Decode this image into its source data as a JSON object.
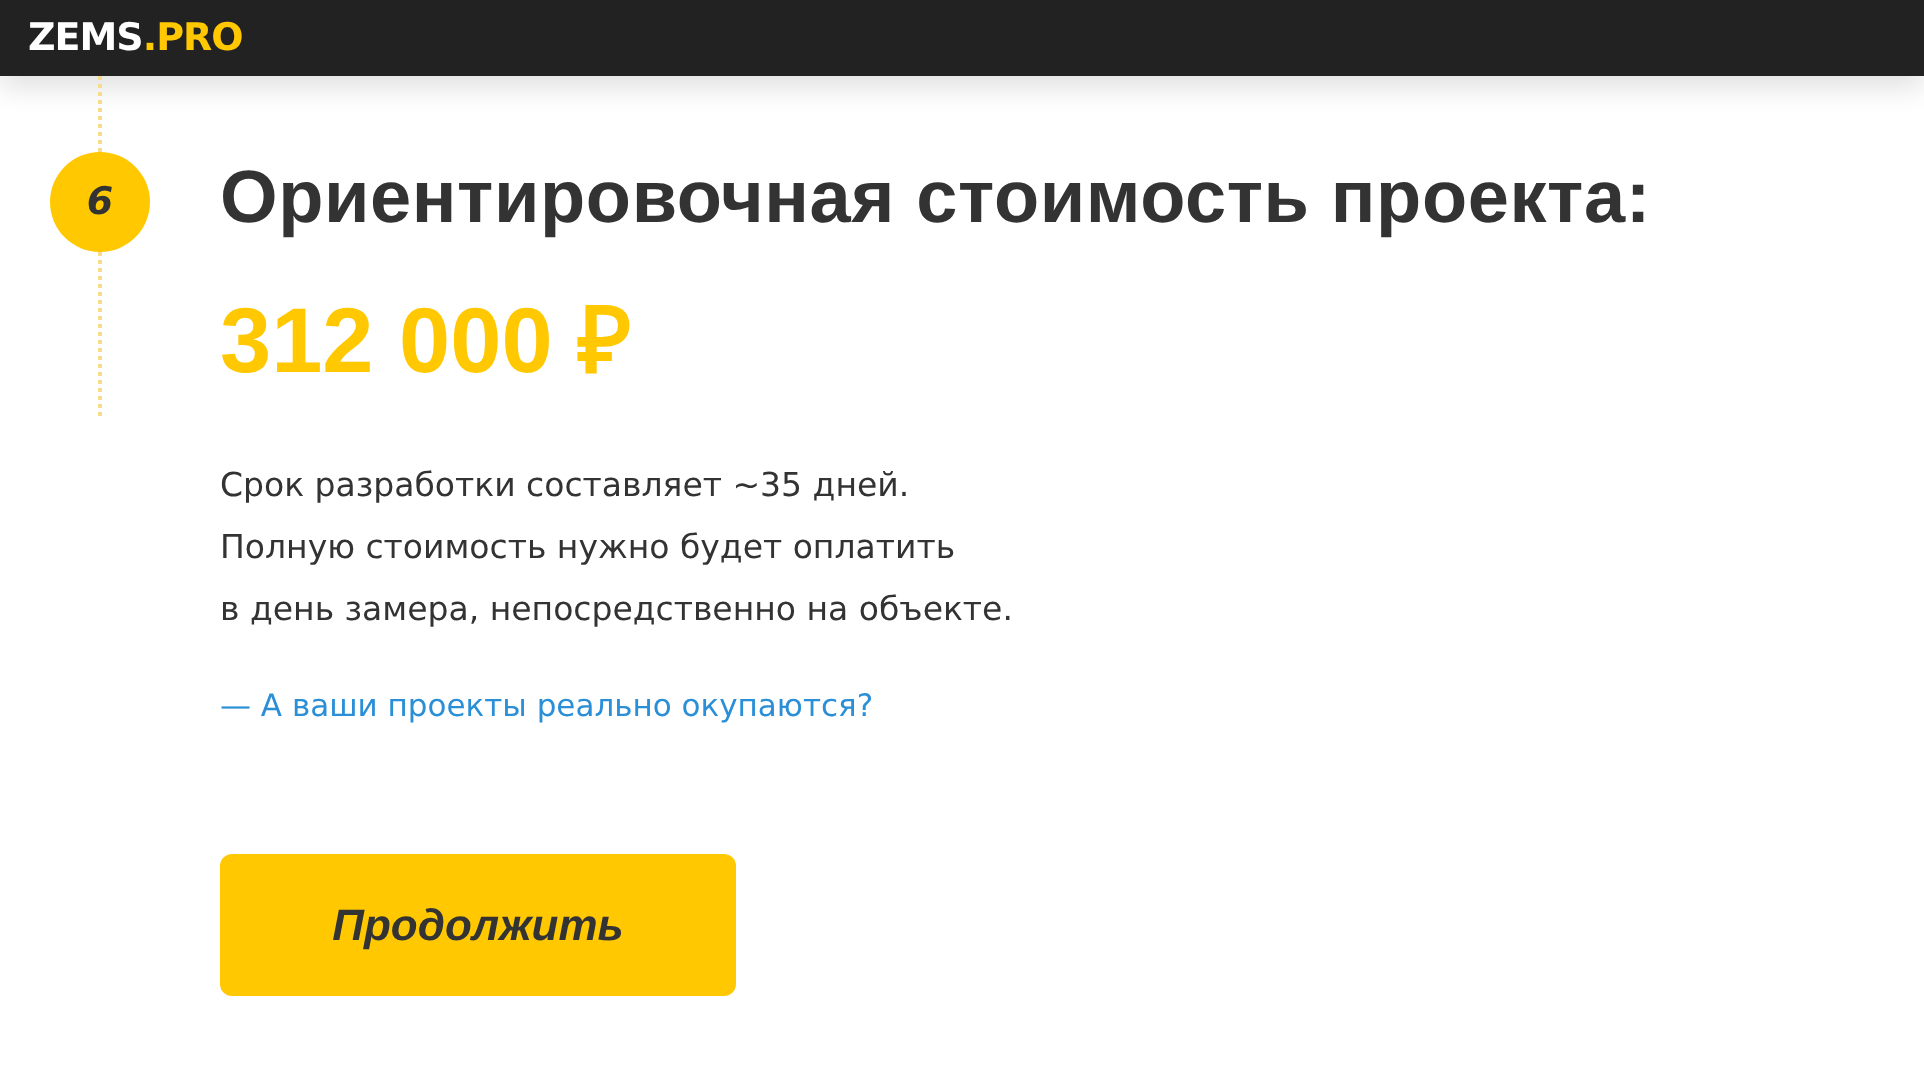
{
  "header": {
    "logo_main": "ZEMS",
    "logo_accent": ".PRO"
  },
  "step": {
    "number": "6",
    "title": "Ориентировочная стоимость проекта:"
  },
  "price": "312 000 ₽",
  "description": [
    "Срок разработки составляет ~35 дней.",
    "Полную стоимость нужно будет оплатить",
    "в день замера, непосредственно на объекте."
  ],
  "faq_link": "— А ваши проекты реально окупаются?",
  "button": "Продолжить"
}
